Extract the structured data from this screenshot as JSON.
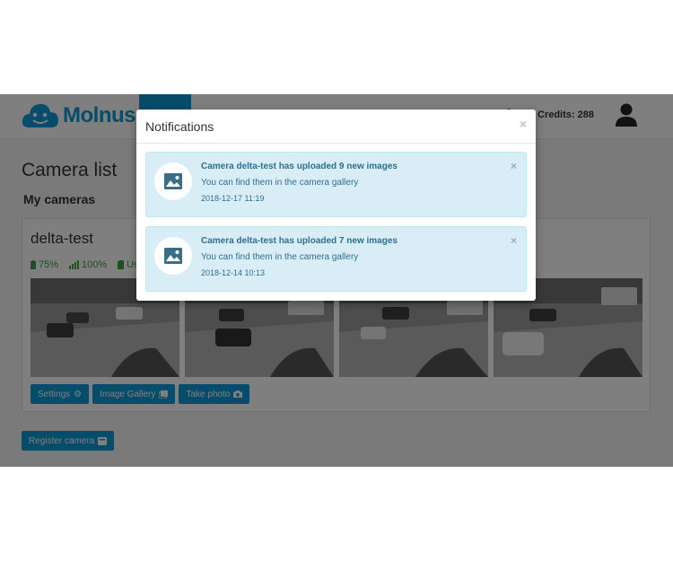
{
  "navbar": {
    "brand": "Molnus",
    "credits_label": "Credits: 288"
  },
  "main": {
    "title": "Camera list",
    "section": "My cameras",
    "camera": {
      "name": "delta-test",
      "battery": "75%",
      "signal": "100%",
      "storage": "Us"
    },
    "buttons": {
      "settings": "Settings",
      "gallery": "Image Gallery",
      "photo": "Take photo"
    },
    "register": "Register camera"
  },
  "modal": {
    "title": "Notifications",
    "close": "×",
    "notifications": [
      {
        "title": "Camera delta-test has uploaded 9 new images",
        "message": "You can find them in the camera gallery",
        "time": "2018-12-17 11:19",
        "close": "×"
      },
      {
        "title": "Camera delta-test has uploaded 7 new images",
        "message": "You can find them in the camera gallery",
        "time": "2018-12-14 10:13",
        "close": "×"
      }
    ]
  },
  "colors": {
    "accent": "#0b9bd7",
    "info_bg": "#d9edf7",
    "info_text": "#2f6f8f",
    "ok_green": "#3aa33a"
  }
}
